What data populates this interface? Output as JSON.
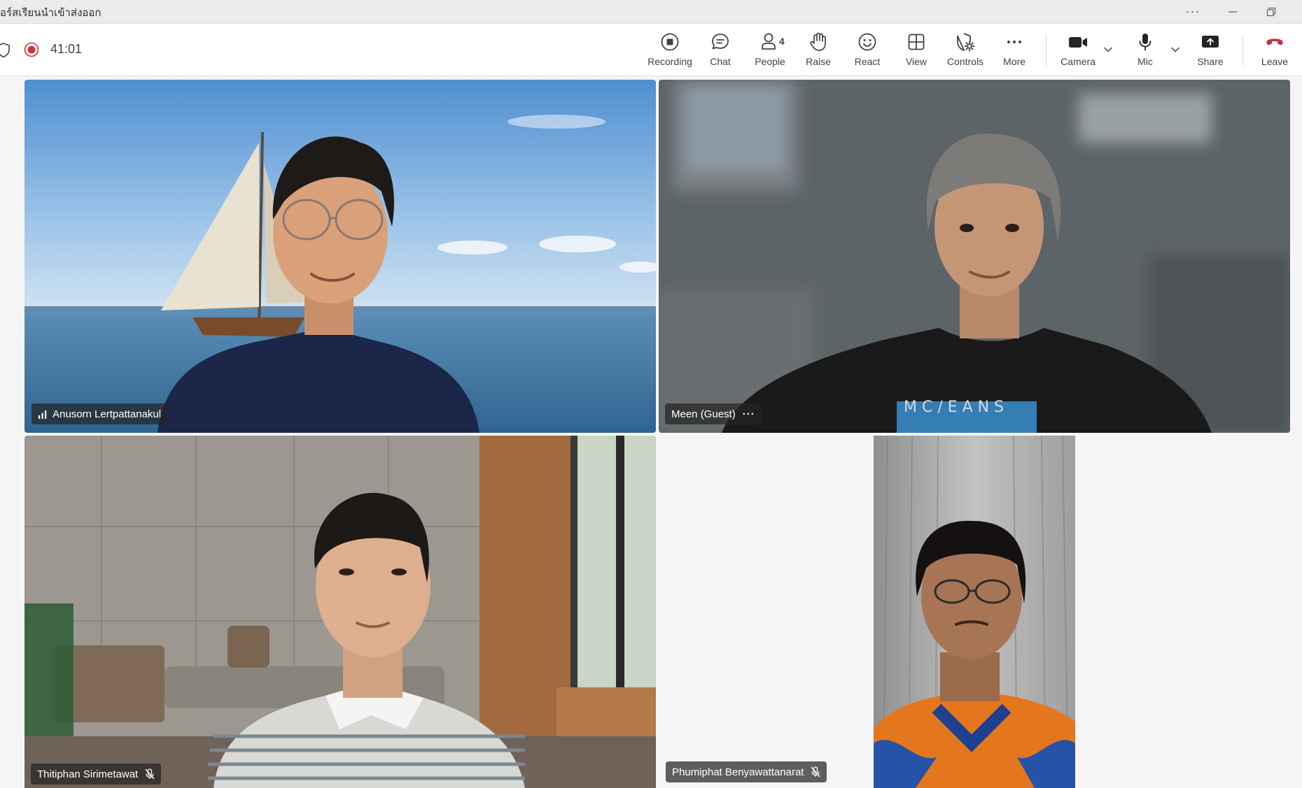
{
  "window": {
    "title": "อร์สเรียนนำเข้าส่งออก",
    "more_label": "···"
  },
  "toolbar": {
    "timer": "41:01",
    "recording_status_color": "#d13438",
    "buttons": {
      "recording": "Recording",
      "chat": "Chat",
      "people": "People",
      "people_count": "4",
      "raise": "Raise",
      "react": "React",
      "view": "View",
      "controls": "Controls",
      "more": "More",
      "camera": "Camera",
      "mic": "Mic",
      "share": "Share",
      "leave": "Leave"
    },
    "leave_color": "#c4314b"
  },
  "participants": [
    {
      "name": "Anusorn Lertpattanakul",
      "indicator": "signal-bars-icon"
    },
    {
      "name": "Meen (Guest)",
      "indicator": "more-options-icon",
      "more_label": "···"
    },
    {
      "name": "Thitiphan Sirimetawat",
      "indicator": "mic-muted-icon"
    },
    {
      "name": "Phumiphat Benyawattanarat",
      "indicator": "mic-muted-icon"
    }
  ]
}
